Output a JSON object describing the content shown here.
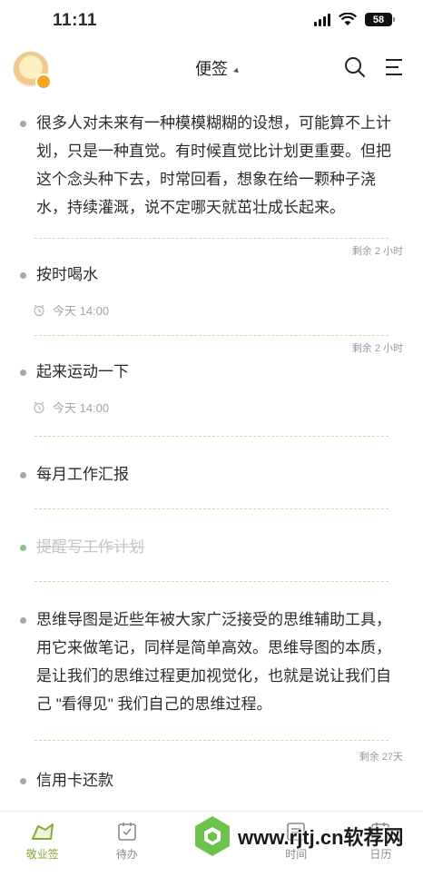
{
  "status_bar": {
    "time": "11:11",
    "battery": "58"
  },
  "header": {
    "title": "便签"
  },
  "notes": [
    {
      "text": "很多人对未来有一种模模糊糊的设想，可能算不上计划，只是一种直觉。有时候直觉比计划更重要。但把这个念头种下去，时常回看，想象在给一颗种子浇水，持续灌溉，说不定哪天就茁壮成长起来。",
      "remaining": "剩余 2 小时"
    },
    {
      "text": "按时喝水",
      "reminder": "今天 14:00",
      "remaining": "剩余 2 小时"
    },
    {
      "text": "起来运动一下",
      "reminder": "今天 14:00"
    },
    {
      "text": "每月工作汇报"
    },
    {
      "text": "提醒写工作计划",
      "done": true
    },
    {
      "text": "思维导图是近些年被大家广泛接受的思维辅助工具，用它来做笔记，同样是简单高效。思维导图的本质，是让我们的思维过程更加视觉化，也就是说让我们自己 \"看得见\" 我们自己的思维过程。",
      "remaining": "剩余 27天"
    },
    {
      "text": "信用卡还款"
    }
  ],
  "tabs": [
    {
      "label": "敬业签",
      "icon": "notes-icon",
      "active": true
    },
    {
      "label": "待办",
      "icon": "todo-icon"
    },
    {
      "label": "",
      "icon": "center-icon"
    },
    {
      "label": "时间",
      "icon": "time-icon"
    },
    {
      "label": "日历",
      "icon": "calendar-icon"
    }
  ],
  "watermark": {
    "text": "www.rjtj.cn软荐网"
  },
  "colors": {
    "accent": "#8aa83a",
    "divider": "#d2dba6",
    "done": "#8bc48a"
  }
}
